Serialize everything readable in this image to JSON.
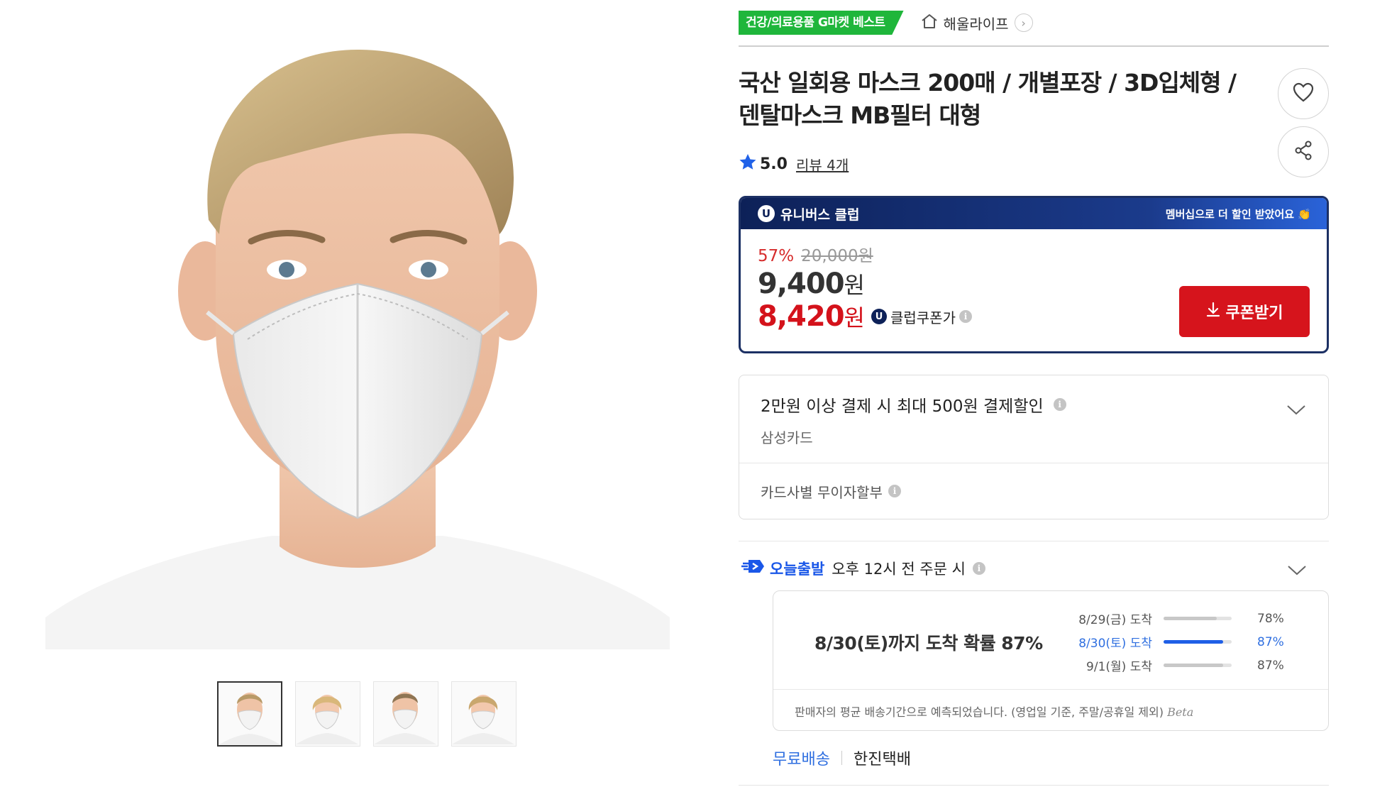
{
  "header": {
    "best_badge": "건강/의료용품 G마켓 베스트",
    "store_name": "해울라이프"
  },
  "product": {
    "title": "국산 일회용 마스크 200매 / 개별포장 / 3D입체형 / 덴탈마스크 MB필터 대형",
    "rating": "5.0",
    "review_label": "리뷰 4개"
  },
  "club": {
    "brand": "유니버스 클럽",
    "notice": "멤버십으로 더 할인 받았어요",
    "discount_rate": "57%",
    "original_price": "20,000원",
    "sale_price": "9,400",
    "coupon_price": "8,420",
    "won": "원",
    "coupon_label": "클럽쿠폰가",
    "coupon_button": "쿠폰받기"
  },
  "card_discount": {
    "title": "2만원 이상 결제 시 최대 500원 결제할인",
    "card_name": "삼성카드",
    "installment": "카드사별 무이자할부"
  },
  "delivery": {
    "today_label": "오늘출발",
    "condition": "오후 12시 전 주문 시",
    "probability_text": "8/30(토)까지 도착 확률 87%",
    "rows": [
      {
        "label": "8/29(금) 도착",
        "pct": "78%",
        "value": 0.78
      },
      {
        "label": "8/30(토) 도착",
        "pct": "87%",
        "value": 0.87
      },
      {
        "label": "9/1(월) 도착",
        "pct": "87%",
        "value": 0.87
      }
    ],
    "note": "판매자의 평균 배송기간으로 예측되었습니다. (영업일 기준, 주말/공휴일 제외)",
    "beta": "Beta",
    "shipping_fee": "무료배송",
    "carrier": "한진택배"
  },
  "colors": {
    "accent_red": "#d6141c",
    "club_navy": "#0d2158",
    "best_green": "#1fb63b",
    "link_blue": "#2f6fe0"
  }
}
